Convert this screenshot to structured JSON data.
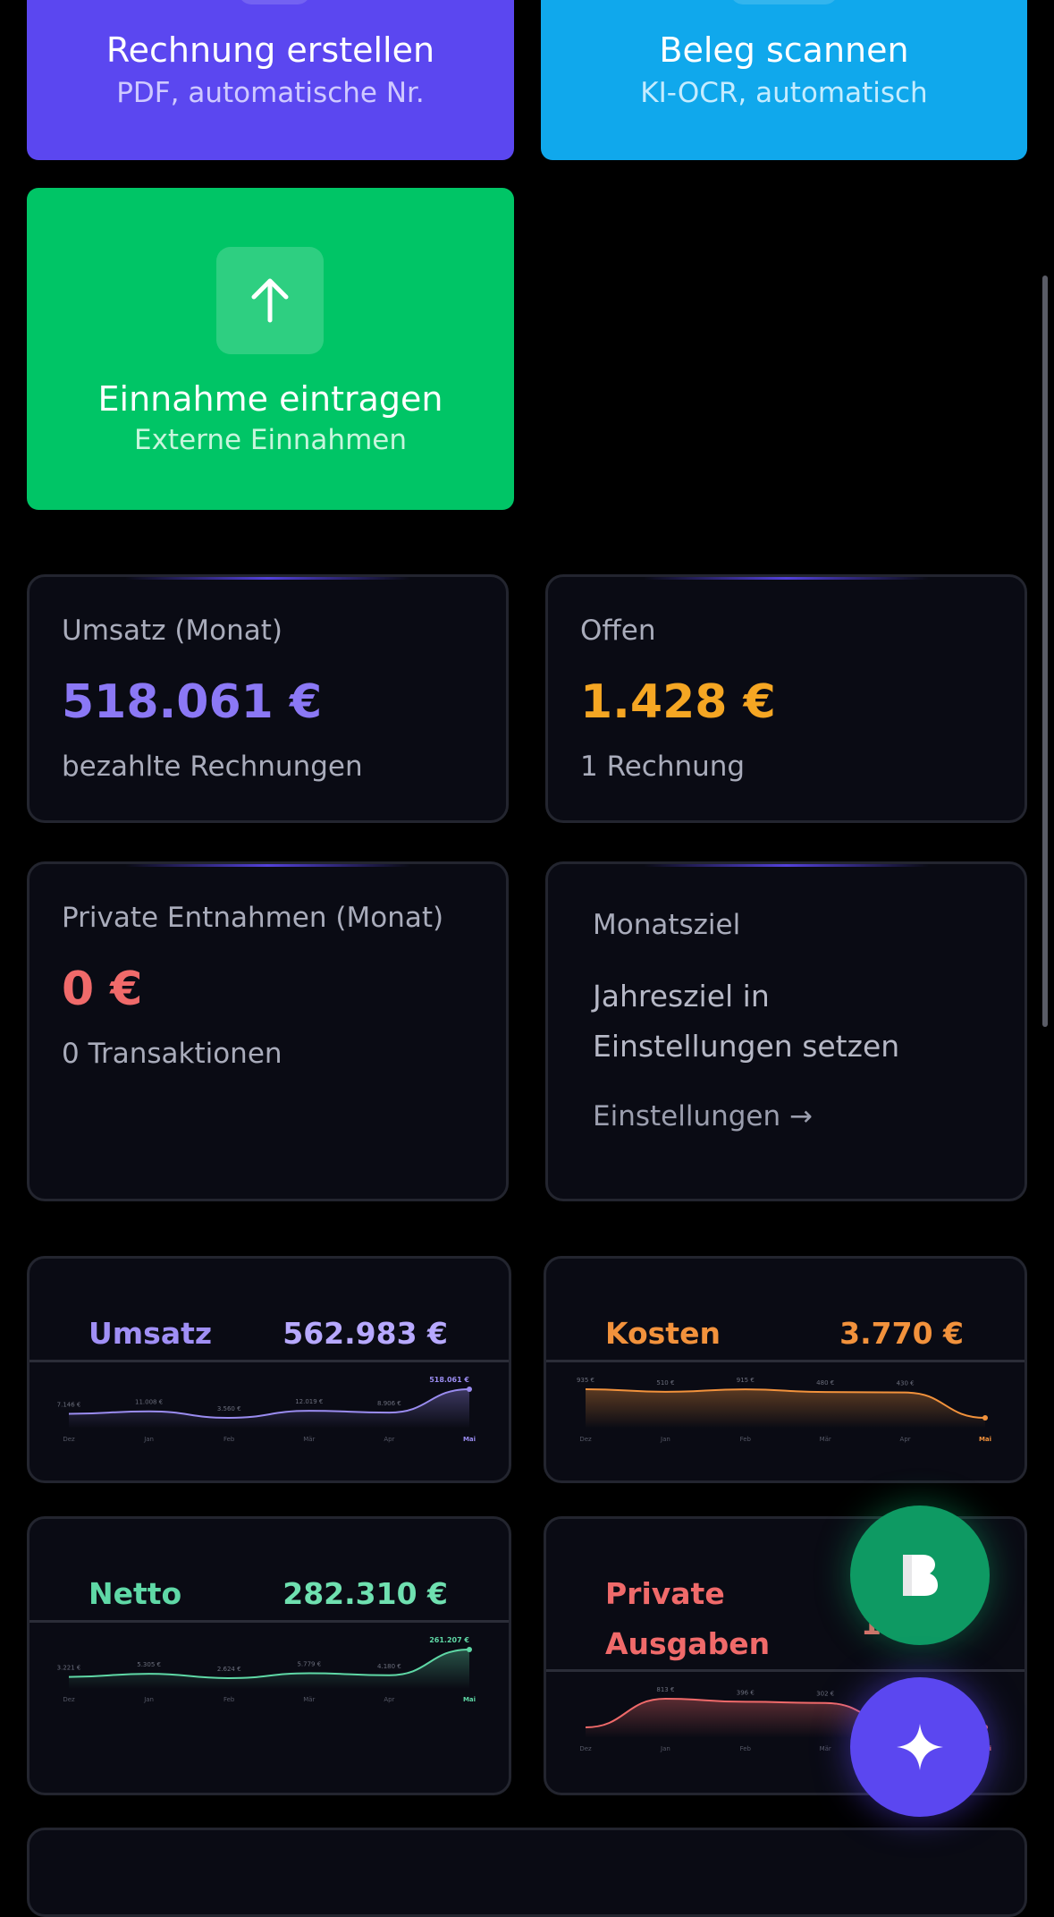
{
  "actions": [
    {
      "title": "Rechnung erstellen",
      "subtitle": "PDF, automatische Nr."
    },
    {
      "title": "Beleg scannen",
      "subtitle": "KI-OCR, automatisch"
    },
    {
      "title": "Einnahme eintragen",
      "subtitle": "Externe Einnahmen"
    }
  ],
  "stats": {
    "umsatz": {
      "label": "Umsatz (Monat)",
      "value": "518.061 €",
      "sub": "bezahlte Rechnungen"
    },
    "offen": {
      "label": "Offen",
      "value": "1.428 €",
      "sub": "1 Rechnung"
    },
    "entnahmen": {
      "label": "Private Entnahmen (Monat)",
      "value": "0 €",
      "sub": "0 Transaktionen"
    },
    "monatsziel": {
      "label": "Monatsziel",
      "text_line1": "Jahresziel in",
      "text_line2": "Einstellungen setzen",
      "link": "Einstellungen →"
    }
  },
  "chart_data": [
    {
      "type": "area",
      "title": "Umsatz",
      "total": "562.983 €",
      "color": "#9a8cf0",
      "categories": [
        "Dez",
        "Jan",
        "Feb",
        "Mär",
        "Apr",
        "Mai"
      ],
      "values": [
        7146,
        11008,
        3560,
        12019,
        8906,
        518061
      ],
      "labels": [
        "7.146 €",
        "11.008 €",
        "3.560 €",
        "12.019 €",
        "8.906 €",
        "518.061 €"
      ]
    },
    {
      "type": "area",
      "title": "Kosten",
      "total": "3.770 €",
      "color": "#f2923c",
      "categories": [
        "Dez",
        "Jan",
        "Feb",
        "Mär",
        "Apr",
        "Mai"
      ],
      "values": [
        935,
        510,
        915,
        480,
        430,
        0
      ],
      "labels": [
        "935 €",
        "510 €",
        "915 €",
        "480 €",
        "430 €",
        ""
      ]
    },
    {
      "type": "area",
      "title": "Netto",
      "total": "282.310 €",
      "color": "#5fd8a6",
      "categories": [
        "Dez",
        "Jan",
        "Feb",
        "Mär",
        "Apr",
        "Mai"
      ],
      "values": [
        3221,
        5305,
        2624,
        5779,
        4180,
        261207
      ],
      "labels": [
        "3.221 €",
        "5.305 €",
        "2.624 €",
        "5.779 €",
        "4.180 €",
        "261.207 €"
      ]
    },
    {
      "type": "area",
      "title": "Private Ausgaben",
      "total": "",
      "color": "#f06a6a",
      "categories": [
        "Dez",
        "Jan",
        "Feb",
        "Mär",
        "Apr",
        "Mai"
      ],
      "values": [
        0,
        813,
        396,
        302,
        0,
        0
      ],
      "labels": [
        "",
        "813 €",
        "396 €",
        "302 €",
        "",
        ""
      ]
    }
  ],
  "private_title_line1": "Private",
  "private_title_line2": "Ausgaben",
  "private_partial": "1.",
  "colors": {
    "accent_purple": "#5b47f0",
    "accent_blue": "#10a8ec",
    "accent_green": "#00c566",
    "orange": "#f5a623",
    "red": "#f06a6a"
  }
}
